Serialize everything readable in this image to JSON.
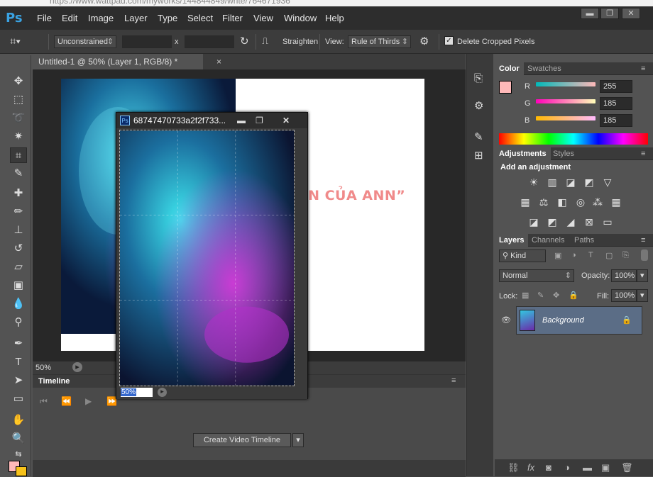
{
  "browser": {
    "url_partial": "https://www.wattpad.com/myworks/144844849/write/764671936"
  },
  "app": {
    "logo": "Ps"
  },
  "menu": [
    "File",
    "Edit",
    "Image",
    "Layer",
    "Type",
    "Select",
    "Filter",
    "View",
    "Window",
    "Help"
  ],
  "window_controls": {
    "minimize": "▬",
    "restore": "❐",
    "close": "✕"
  },
  "options": {
    "ratio_value": "Unconstrained",
    "x_sep": "x",
    "straighten_label": "Straighten",
    "view_label": "View:",
    "view_value": "Rule of Thirds",
    "delete_cropped_label": "Delete Cropped Pixels"
  },
  "document": {
    "tab_title": "Untitled-1 @ 50% (Layer 1, RGB/8) *",
    "zoom": "50%",
    "overlay_text": "GN CỦA ANN”"
  },
  "floating_window": {
    "title": "68747470733a2f2f733...",
    "zoom": "50%"
  },
  "timeline": {
    "title": "Timeline",
    "create_button": "Create Video Timeline"
  },
  "color_panel": {
    "tabs": [
      "Color",
      "Swatches"
    ],
    "r_label": "R",
    "g_label": "G",
    "b_label": "B",
    "r": "255",
    "g": "185",
    "b": "185",
    "fg_color": "#ffb9b9",
    "bg_color": "#f7c21a"
  },
  "adjustments_panel": {
    "tabs": [
      "Adjustments",
      "Styles"
    ],
    "heading": "Add an adjustment"
  },
  "layers_panel": {
    "tabs": [
      "Layers",
      "Channels",
      "Paths"
    ],
    "kind_label": "Kind",
    "blend_mode": "Normal",
    "opacity_label": "Opacity:",
    "opacity_value": "100%",
    "lock_label": "Lock:",
    "fill_label": "Fill:",
    "fill_value": "100%",
    "layer_name": "Background"
  }
}
